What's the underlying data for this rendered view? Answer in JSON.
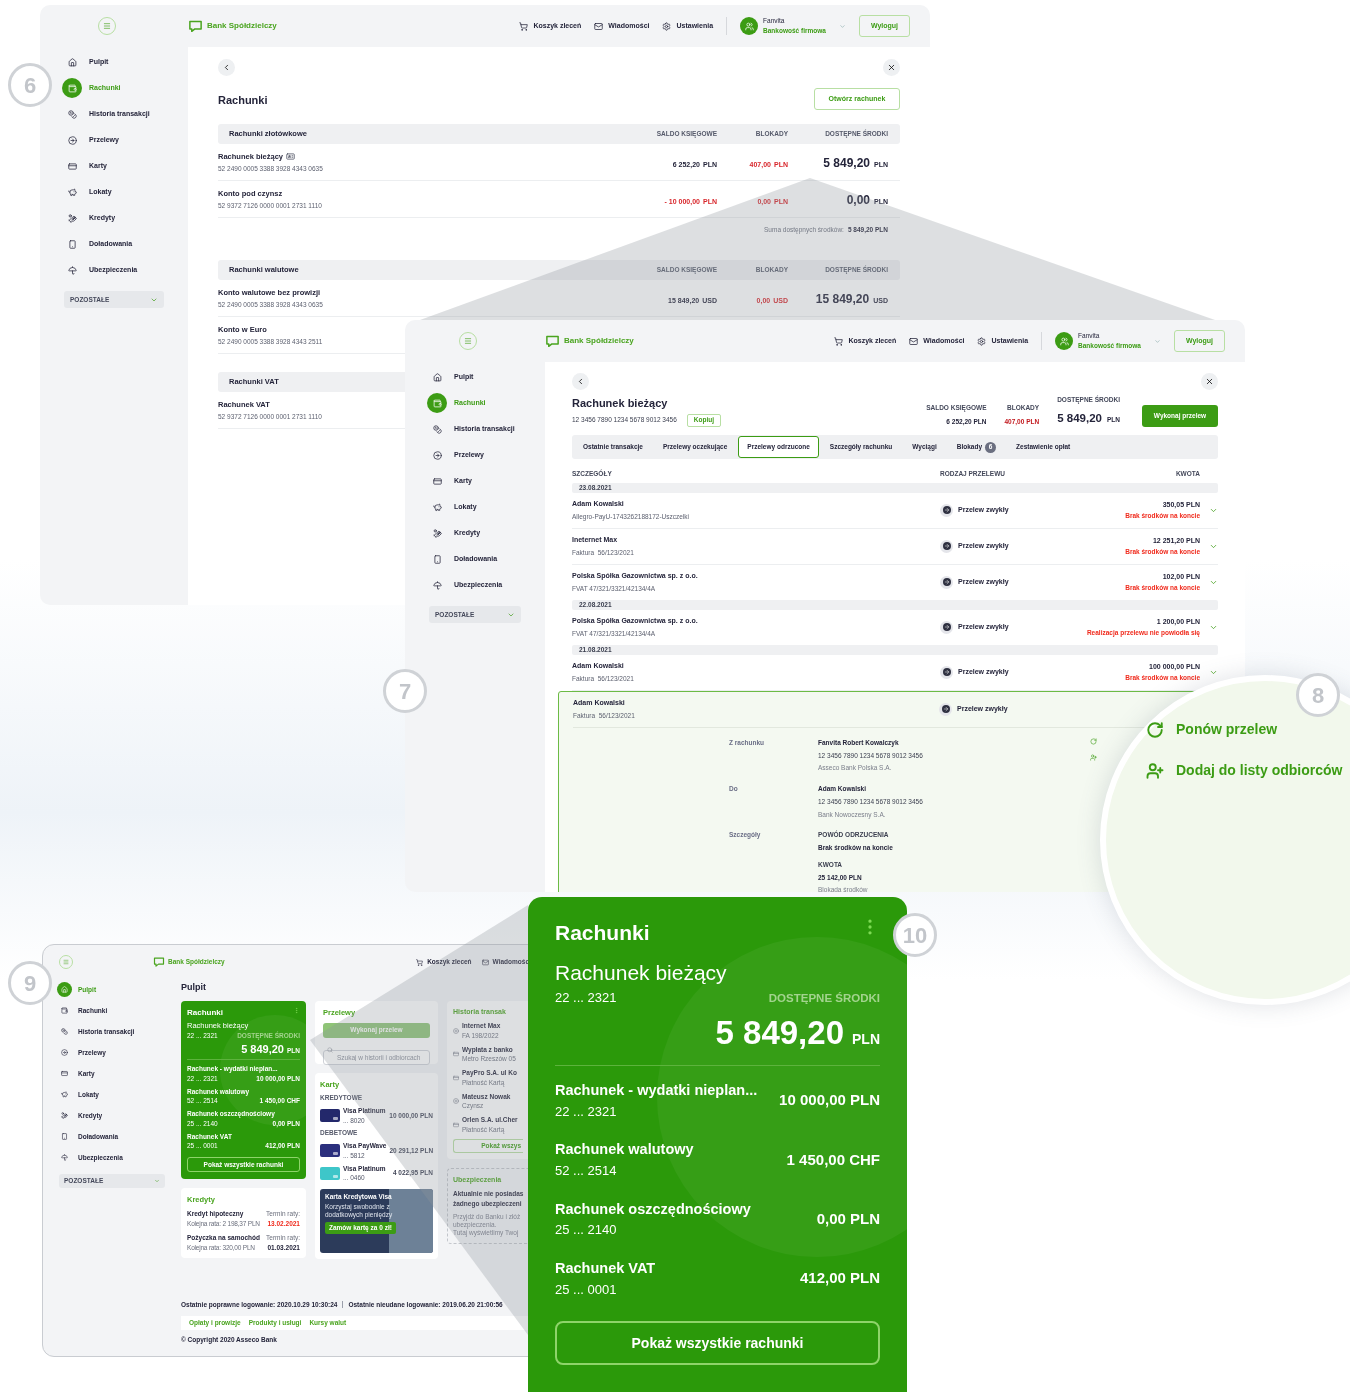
{
  "callouts": [
    "6",
    "7",
    "8",
    "9",
    "10"
  ],
  "accounts_window": {
    "header": {
      "brand": "Bank Spółdzielczy",
      "nav": [
        "Koszyk zleceń",
        "Wiadomości",
        "Ustawienia"
      ],
      "user_name": "Fanvita",
      "user_role": "Bankowość firmowa",
      "logout": "Wyloguj"
    },
    "sidebar": [
      {
        "label": "Pulpit",
        "selected": false
      },
      {
        "label": "Rachunki",
        "selected": true
      },
      {
        "label": "Historia transakcji",
        "selected": false
      },
      {
        "label": "Przelewy",
        "selected": false
      },
      {
        "label": "Karty",
        "selected": false
      },
      {
        "label": "Lokaty",
        "selected": false
      },
      {
        "label": "Kredyty",
        "selected": false
      },
      {
        "label": "Doładowania",
        "selected": false
      },
      {
        "label": "Ubezpieczenia",
        "selected": false
      }
    ],
    "sidebar_more": "POZOSTAŁE",
    "title": "Rachunki",
    "open_button": "Otwórz rachunek",
    "groups": [
      {
        "title": "Rachunki złotówkowe",
        "columns": [
          "SALDO KSIĘGOWE",
          "BLOKADY",
          "DOSTĘPNE ŚRODKI"
        ],
        "rows": [
          {
            "name": "Rachunek bieżący",
            "badge_icon": true,
            "number": "52 2490 0005 3388 3928 4343 0635",
            "balance": {
              "value": "6 252,20",
              "currency": "PLN",
              "negative": false
            },
            "blocked": {
              "value": "407,00",
              "currency": "PLN"
            },
            "available": {
              "value": "5 849,20",
              "currency": "PLN"
            }
          },
          {
            "name": "Konto pod czynsz",
            "badge_icon": false,
            "number": "52 9372 7126 0000 0001 2731 1110",
            "balance": {
              "value": "- 10 000,00",
              "currency": "PLN",
              "negative": true
            },
            "blocked": {
              "value": "0,00",
              "currency": "PLN"
            },
            "available": {
              "value": "0,00",
              "currency": "PLN"
            }
          }
        ],
        "summary": {
          "label": "Suma dostępnych środków:",
          "value": "5 849,20 PLN"
        }
      },
      {
        "title": "Rachunki walutowe",
        "columns": [
          "SALDO KSIĘGOWE",
          "BLOKADY",
          "DOSTĘPNE ŚRODKI"
        ],
        "rows": [
          {
            "name": "Konto walutowe bez prowizji",
            "badge_icon": false,
            "number": "52 2490 0005 3388 3928 4343 0635",
            "balance": {
              "value": "15 849,20",
              "currency": "USD",
              "negative": false
            },
            "blocked": {
              "value": "0,00",
              "currency": "USD"
            },
            "available": {
              "value": "15 849,20",
              "currency": "USD"
            }
          },
          {
            "name": "Konto w Euro",
            "badge_icon": false,
            "number": "52 2490 0005 3388 3928 4343 2511"
          }
        ]
      },
      {
        "title": "Rachunki VAT",
        "rows": [
          {
            "name": "Rachunek VAT",
            "badge_icon": false,
            "number": "52 9372 7126 0000 0001 2731 1110"
          }
        ]
      }
    ]
  },
  "account_window": {
    "header": {
      "brand": "Bank Spółdzielczy",
      "nav": [
        "Koszyk zleceń",
        "Wiadomości",
        "Ustawienia"
      ],
      "user_name": "Fanvita",
      "user_role": "Bankowość firmowa",
      "logout": "Wyloguj"
    },
    "sidebar": [
      {
        "label": "Pulpit",
        "selected": false
      },
      {
        "label": "Rachunki",
        "selected": true
      },
      {
        "label": "Historia transakcji",
        "selected": false
      },
      {
        "label": "Przelewy",
        "selected": false
      },
      {
        "label": "Karty",
        "selected": false
      },
      {
        "label": "Lokaty",
        "selected": false
      },
      {
        "label": "Kredyty",
        "selected": false
      },
      {
        "label": "Doładowania",
        "selected": false
      },
      {
        "label": "Ubezpieczenia",
        "selected": false
      }
    ],
    "sidebar_more": "POZOSTAŁE",
    "title": "Rachunek bieżący",
    "number": "12 3456 7890 1234 5678 9012 3456",
    "copy_button": "Kopiuj",
    "stats": [
      {
        "label": "SALDO KSIĘGOWE",
        "value": "6 252,20 PLN",
        "kind": "plain"
      },
      {
        "label": "BLOKADY",
        "value": "407,00 PLN",
        "kind": "blocked"
      },
      {
        "label": "DOSTĘPNE ŚRODKI",
        "value": "5 849,20",
        "currency": "PLN",
        "kind": "main"
      }
    ],
    "transfer_button": "Wykonaj przelew",
    "tabs": [
      {
        "label": "Ostatnie transakcje",
        "selected": false
      },
      {
        "label": "Przelewy oczekujące",
        "selected": false
      },
      {
        "label": "Przelewy odrzucone",
        "selected": true
      },
      {
        "label": "Szczegóły rachunku",
        "selected": false
      },
      {
        "label": "Wyciągi",
        "selected": false
      },
      {
        "label": "Blokady",
        "selected": false,
        "count": "6"
      },
      {
        "label": "Zestawienie opłat",
        "selected": false
      }
    ],
    "columns": [
      "SZCZEGÓŁY",
      "RODZAJ PRZELEWU",
      "KWOTA"
    ],
    "days": [
      {
        "date": "23.08.2021",
        "rows": [
          {
            "name": "Adam Kowalski",
            "title": "Allegro-PayU-1743262188172-Uszczelki",
            "type": "Przelew zwykły",
            "amount": "350,05 PLN",
            "status": "Brak środków na koncie",
            "expanded": false
          },
          {
            "name": "Ineternet Max",
            "title": "Faktura  56/123/2021",
            "type": "Przelew zwykły",
            "amount": "12 251,20 PLN",
            "status": "Brak środków na koncie",
            "expanded": false
          },
          {
            "name": "Polska Spółka Gazownictwa sp. z o.o.",
            "title": "FVAT 47/321/3321/42134/4A",
            "type": "Przelew zwykły",
            "amount": "102,00 PLN",
            "status": "Brak środków na koncie",
            "expanded": false
          }
        ]
      },
      {
        "date": "22.08.2021",
        "rows": [
          {
            "name": "Polska Spółka Gazownictwa sp. z o.o.",
            "title": "FVAT 47/321/3321/42134/4A",
            "type": "Przelew zwykły",
            "amount": "1 200,00 PLN",
            "status": "Realizacja przelewu nie powiodła się",
            "expanded": false
          }
        ]
      },
      {
        "date": "21.08.2021",
        "rows": [
          {
            "name": "Adam Kowalski",
            "title": "Faktura  56/123/2021",
            "type": "Przelew zwykły",
            "amount": "100 000,00 PLN",
            "status": "Brak środków na koncie",
            "expanded": false
          },
          {
            "name": "Adam Kowalski",
            "title": "Faktura  56/123/2021",
            "type": "Przelew zwykły",
            "expanded": true,
            "details": [
              {
                "label": "Z rachunku",
                "lines": [
                  {
                    "text": "Fanvita Robert Kowalczyk",
                    "kind": "strong"
                  },
                  {
                    "text": "12 3456 7890 1234 5678 9012 3456",
                    "kind": "plain"
                  },
                  {
                    "text": "Asseco Bank Polska S.A.",
                    "kind": "muted"
                  }
                ]
              },
              {
                "label": "Do",
                "lines": [
                  {
                    "text": "Adam Kowalski",
                    "kind": "strong"
                  },
                  {
                    "text": "12 3456 7890 1234 5678 9012 3456",
                    "kind": "plain"
                  },
                  {
                    "text": "Bank Nowoczesny S.A.",
                    "kind": "muted"
                  }
                ]
              },
              {
                "label": "Szczegóły",
                "lines": [
                  {
                    "text": "POWÓD ODRZUCENIA",
                    "kind": "caption"
                  },
                  {
                    "text": "Brak środków na koncie",
                    "kind": "strong"
                  },
                  {
                    "text": "KWOTA",
                    "kind": "caption"
                  },
                  {
                    "text": "25 142,00 PLN",
                    "kind": "strong"
                  },
                  {
                    "text": "Blokada środków",
                    "kind": "muted"
                  }
                ]
              }
            ]
          }
        ]
      }
    ]
  },
  "magnified_actions": [
    {
      "label": "Ponów przelew",
      "kind": "retry"
    },
    {
      "label": "Dodaj do listy odbiorców",
      "kind": "add_recipient"
    }
  ],
  "dashboard": {
    "header": {
      "brand": "Bank Spółdzielczy",
      "nav": [
        "Koszyk zleceń",
        "Wiadomośc"
      ]
    },
    "sidebar": [
      {
        "label": "Pulpit",
        "selected": true
      },
      {
        "label": "Rachunki",
        "selected": false
      },
      {
        "label": "Historia transakcji",
        "selected": false
      },
      {
        "label": "Przelewy",
        "selected": false
      },
      {
        "label": "Karty",
        "selected": false
      },
      {
        "label": "Lokaty",
        "selected": false
      },
      {
        "label": "Kredyty",
        "selected": false
      },
      {
        "label": "Doładowania",
        "selected": false
      },
      {
        "label": "Ubezpieczenia",
        "selected": false
      }
    ],
    "sidebar_more": "POZOSTAŁE",
    "title": "Pulpit",
    "accounts_card": {
      "title": "Rachunki",
      "account": "Rachunek bieżący",
      "number": "22 ... 2321",
      "available_label": "DOSTĘPNE ŚRODKI",
      "available": "5 849,20",
      "currency": "PLN",
      "rows": [
        {
          "name": "Rachunek - wydatki nieplan...",
          "number": "22 ... 2321",
          "amount": "10 000,00 PLN"
        },
        {
          "name": "Rachunek walutowy",
          "number": "52 ... 2514",
          "amount": "1 450,00 CHF"
        },
        {
          "name": "Rachunek oszczędnościowy",
          "number": "25 ... 2140",
          "amount": "0,00 PLN"
        },
        {
          "name": "Rachunek VAT",
          "number": "25 ... 0001",
          "amount": "412,00 PLN"
        }
      ],
      "button": "Pokaż wszystkie rachunki"
    },
    "loans": {
      "title": "Kredyty",
      "items": [
        {
          "name": "Kredyt hipoteczny",
          "installment": "Kolejna rata: 2 198,37 PLN",
          "due_label": "Termin raty:",
          "due_date": "13.02.2021",
          "overdue": true
        },
        {
          "name": "Pożyczka na samochód",
          "installment": "Kolejna rata: 320,00 PLN",
          "due_label": "Termin raty:",
          "due_date": "01.03.2021",
          "overdue": false
        }
      ]
    },
    "transfers": {
      "title": "Przelewy",
      "button": "Wykonaj przelew",
      "search_placeholder": "Szukaj w historii i odbiorcach"
    },
    "cards": {
      "title": "Karty",
      "sections": [
        {
          "title": "KREDYTOWE",
          "items": [
            {
              "name": "Visa Platinum",
              "number": "... 8020",
              "limit": "10 000,00 PLN",
              "color": "#23286b"
            }
          ]
        },
        {
          "title": "DEBETOWE",
          "items": [
            {
              "name": "Visa PayWave",
              "number": "... 5812",
              "limit": "20 291,12 PLN",
              "color": "#2b2f7d"
            },
            {
              "name": "Visa Platinum",
              "number": "... 0460",
              "limit": "4 022,95 PLN",
              "color": "#3ec6c9"
            }
          ]
        }
      ],
      "promo": {
        "title": "Karta Kredytowa Visa",
        "text": "Korzystaj swobodnie z dodatkowych pieniędzy",
        "button": "Zamów kartę za 0 zł!"
      }
    },
    "history": {
      "title": "Historia transak",
      "items": [
        {
          "name": "Internet Max",
          "detail": "FA 198/2022",
          "kind": "transfer"
        },
        {
          "name": "Wypłata z banko",
          "detail": "Metro Rzeszów 05",
          "kind": "card"
        },
        {
          "name": "PayPro S.A. ul Ko",
          "detail": "Płatność Kartą",
          "kind": "card"
        },
        {
          "name": "Mateusz Nowak",
          "detail": "Czynsz",
          "kind": "transfer"
        },
        {
          "name": "Orlen S.A. ul.Cher",
          "detail": "Płatność Kartą",
          "kind": "card"
        }
      ],
      "button": "Pokaż wszys"
    },
    "insurance": {
      "title": "Ubezpieczenia",
      "lines": [
        "Aktualnie nie posiadas",
        "żadnego ubezpieczeni"
      ],
      "hint_lines": [
        "Przyjdź do Banku i złóż",
        "ubezpieczenia.",
        "Tutaj wyświetlimy Twoj"
      ]
    },
    "footer": {
      "last_login": "Ostatnie poprawne logowanie: 2020.10.29 10:30:24",
      "failed_login": "Ostatnie nieudane logowanie: 2019.06.20 21:00:56",
      "links": [
        "Opłaty i prowizje",
        "Produkty i usługi",
        "Kursy walut"
      ],
      "copyright": "© Copyright 2020 Asseco Bank"
    }
  },
  "zoomed_card": {
    "title": "Rachunki",
    "account": "Rachunek bieżący",
    "number": "22 ... 2321",
    "available_label": "DOSTĘPNE ŚRODKI",
    "available": "5 849,20",
    "currency": "PLN",
    "rows": [
      {
        "name": "Rachunek - wydatki nieplan...",
        "number": "22 ... 2321",
        "amount": "10 000,00 PLN"
      },
      {
        "name": "Rachunek walutowy",
        "number": "52 ... 2514",
        "amount": "1 450,00 CHF"
      },
      {
        "name": "Rachunek oszczędnościowy",
        "number": "25 ... 2140",
        "amount": "0,00 PLN"
      },
      {
        "name": "Rachunek VAT",
        "number": "25 ... 0001",
        "amount": "412,00 PLN"
      }
    ],
    "button": "Pokaż wszystkie rachunki"
  }
}
